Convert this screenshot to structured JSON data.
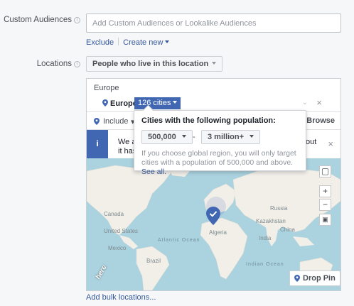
{
  "custom_audiences": {
    "label": "Custom Audiences",
    "placeholder": "Add Custom Audiences or Lookalike Audiences",
    "exclude_link": "Exclude",
    "create_new_link": "Create new"
  },
  "locations": {
    "label": "Locations",
    "type_select": "People who live in this location",
    "group_header": "Europe",
    "selected_location": "Europe",
    "cities_tag": "126 cities",
    "include_label": "Include",
    "browse_label": "Browse",
    "info_banner": {
      "line1_start": "We a",
      "line1_end": "out",
      "line2_start": "it has",
      "icon": "i"
    },
    "map": {
      "labels": [
        "Canada",
        "United States",
        "Mexico",
        "Brazil",
        "Russia",
        "China",
        "India",
        "Algeria",
        "Kazakhstan"
      ],
      "oceans": [
        "Atlantic Ocean",
        "Indian Ocean"
      ],
      "attribution": "here",
      "drop_pin_label": "Drop Pin",
      "zoom_in": "+",
      "zoom_out": "−"
    },
    "bulk_link": "Add bulk locations..."
  },
  "popover": {
    "title": "Cities with the following population:",
    "min_value": "500,000",
    "max_value": "3 million+",
    "dash": "-",
    "note": "If you choose global region, you will only target cities with a population of 500,000 and above.",
    "see_all": "See all."
  },
  "colors": {
    "accent": "#4267b2",
    "link": "#365899",
    "ocean": "#abd3df",
    "land": "#f2efe9"
  }
}
